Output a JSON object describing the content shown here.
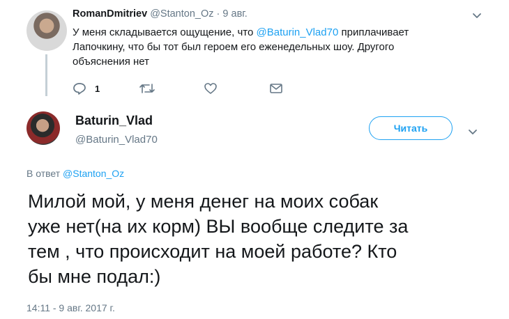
{
  "parent_tweet": {
    "author_name": "RomanDmitriev",
    "author_handle": "@Stanton_Oz",
    "separator": "·",
    "date": "9 авг.",
    "text_before": "У меня складывается ощущение, что ",
    "mention": "@Baturin_Vlad70",
    "text_after": " приплачивает Лапочкину, что бы тот был героем его еженедельных шоу. Другого объяснения нет",
    "reply_count": "1",
    "icons": [
      "reply-icon",
      "retweet-icon",
      "like-icon",
      "direct-message-icon",
      "chevron-down-icon"
    ]
  },
  "main_tweet": {
    "author_name": "Baturin_Vlad",
    "author_handle": "@Baturin_Vlad70",
    "follow_label": "Читать",
    "reply_prefix": "В ответ ",
    "reply_to_handle": "@Stanton_Oz",
    "text": "Милой мой, у меня денег на моих собак\nуже нет(на их  корм) ВЫ вообще следите за\nтем , что происходит на моей работе? Кто\nбы мне подал:)",
    "timestamp": "14:11 - 9 авг. 2017 г."
  },
  "colors": {
    "accent": "#1da1f2",
    "muted": "#657786",
    "text": "#14171a",
    "thread_line": "#c4cfd6"
  }
}
